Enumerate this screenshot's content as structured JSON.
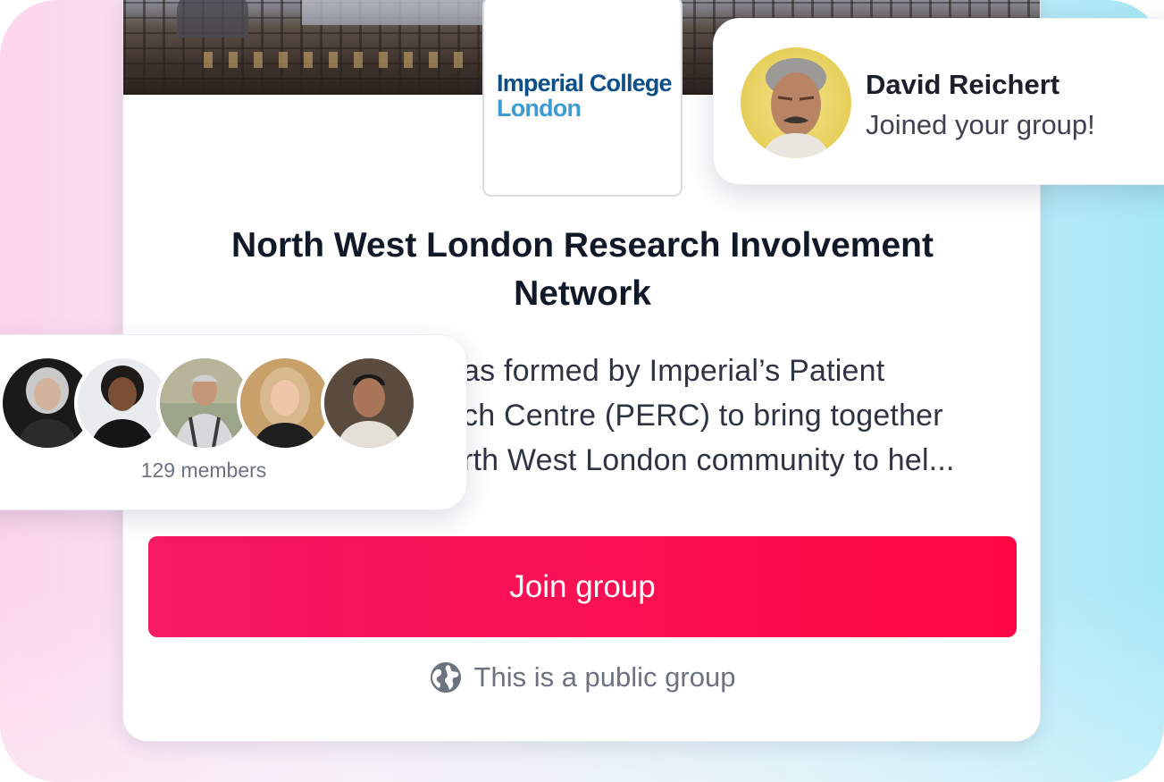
{
  "group": {
    "logo_line1": "Imperial College",
    "logo_line2": "London",
    "title": "North West London Research Involvement Network",
    "description": "as formed by Imperial’s Patient\nch Centre (PERC) to bring together\nrth West London community to hel...",
    "join_label": "Join group",
    "public_label": "This is a public group",
    "public_icon": "globe-icon"
  },
  "notification": {
    "name": "David Reichert",
    "message": "Joined your group!",
    "avatar_icon": "user-avatar"
  },
  "members": {
    "count_label": "129 members",
    "avatars": [
      "member-avatar-1",
      "member-avatar-2",
      "member-avatar-3",
      "member-avatar-4",
      "member-avatar-5"
    ]
  },
  "colors": {
    "accent": "#ff0a4a",
    "logo_dark_blue": "#0b4e8a",
    "logo_light_blue": "#3c9bd3",
    "title_text": "#111827",
    "muted_text": "#6b7280"
  }
}
